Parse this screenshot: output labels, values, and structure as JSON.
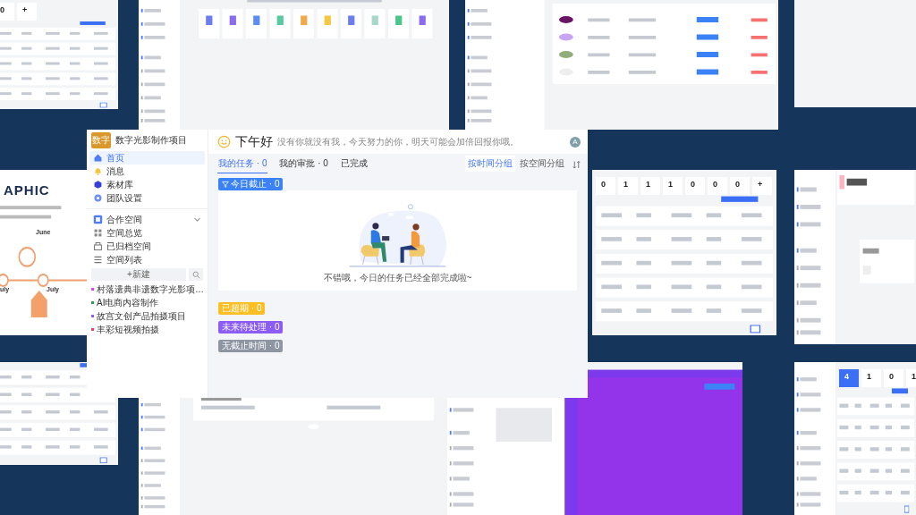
{
  "app": {
    "logo": "数字",
    "name": "数字光影制作项目"
  },
  "nav": [
    {
      "label": "首页",
      "selected": true
    },
    {
      "label": "消息",
      "selected": false
    },
    {
      "label": "素材库",
      "selected": false
    },
    {
      "label": "团队设置",
      "selected": false
    }
  ],
  "space": {
    "title": "合作空间",
    "expanded": true,
    "new_button": "+新建",
    "items": [
      {
        "label": "空间总览"
      },
      {
        "label": "已归档空间"
      },
      {
        "label": "空间列表"
      }
    ]
  },
  "projects": [
    {
      "name": "村落遗典非遗数字光影项…",
      "color": "#d946ef",
      "selected": false
    },
    {
      "name": "AI电商内容制作",
      "color": "#22a447",
      "selected": false
    },
    {
      "name": "故宫文创产品拍摄项目",
      "color": "#8b5cf6",
      "selected": false
    },
    {
      "name": "丰彩短视频拍摄",
      "color": "#f43f5e",
      "selected": false
    }
  ],
  "header": {
    "greeting": "下午好",
    "subtitle": "没有你就没有我，今天努力的你，明天可能会加倍回报你哦。",
    "avatar": "A"
  },
  "tabs": [
    {
      "label": "我的任务 · 0",
      "selected": true
    },
    {
      "label": "我的审批 · 0",
      "selected": false
    },
    {
      "label": "已完成",
      "selected": false
    }
  ],
  "grouping": [
    {
      "label": "按时间分组",
      "selected": true
    },
    {
      "label": "按空间分组",
      "selected": false
    }
  ],
  "groups": [
    {
      "label": "今日截止 · 0",
      "color": "#3b82f6",
      "expanded": true,
      "empty_text": "不错哦，今日的任务已经全部完成啦~"
    },
    {
      "label": "已超期 · 0",
      "color": "#fbbf24",
      "expanded": false
    },
    {
      "label": "未来待处理 · 0",
      "color": "#8b5cf6",
      "expanded": false
    },
    {
      "label": "无截止时间 · 0",
      "color": "#8e96a3",
      "expanded": false
    }
  ],
  "background_screens": [
    {
      "kind": "table",
      "stats": [
        "0",
        "+"
      ]
    },
    {
      "kind": "launcher"
    },
    {
      "kind": "members"
    },
    {
      "kind": "blank"
    },
    {
      "kind": "infographic",
      "title": "APHIC",
      "labels": [
        "June",
        "uly",
        "July"
      ]
    },
    {
      "kind": "table",
      "stats": [
        "0",
        "1",
        "1",
        "1",
        "0",
        "0",
        "0",
        "+"
      ]
    },
    {
      "kind": "project"
    },
    {
      "kind": "table"
    },
    {
      "kind": "board"
    },
    {
      "kind": "upload"
    },
    {
      "kind": "dashboard",
      "stats": [
        "4",
        "1",
        "0",
        "1"
      ]
    }
  ]
}
